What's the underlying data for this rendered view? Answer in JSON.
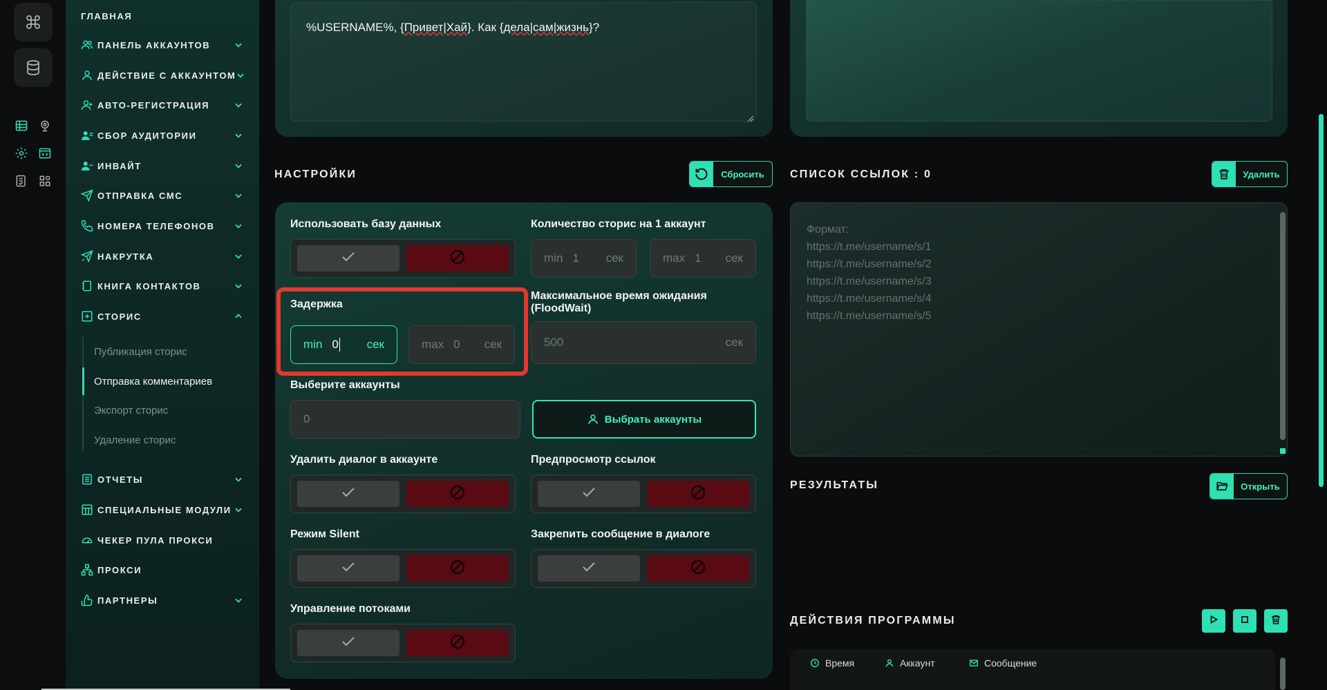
{
  "colors": {
    "accent": "#2ee0b3",
    "danger": "#5a0a12",
    "highlight": "#e2392d",
    "sidebar_bg": "#0f2a26"
  },
  "rail": {
    "icons": [
      "command-icon",
      "database-icon",
      "table-icon",
      "webcam-icon",
      "settings-icon",
      "code-window-icon",
      "checklist-icon",
      "apps-icon"
    ]
  },
  "sidebar": {
    "home": "ГЛАВНАЯ",
    "items": [
      {
        "label": "ПАНЕЛЬ АККАУНТОВ",
        "icon": "users-icon"
      },
      {
        "label": "ДЕЙСТВИЕ С АККАУНТОМ",
        "icon": "user-icon"
      },
      {
        "label": "АВТО-РЕГИСТРАЦИЯ",
        "icon": "user-plus-icon"
      },
      {
        "label": "СБОР АУДИТОРИИ",
        "icon": "user-list-icon"
      },
      {
        "label": "ИНВАЙТ",
        "icon": "user-invite-icon"
      },
      {
        "label": "ОТПРАВКА СМС",
        "icon": "send-icon"
      },
      {
        "label": "НОМЕРА ТЕЛЕФОНОВ",
        "icon": "phone-icon"
      },
      {
        "label": "НАКРУТКА",
        "icon": "boost-send-icon"
      },
      {
        "label": "КНИГА КОНТАКТОВ",
        "icon": "contacts-book-icon"
      },
      {
        "label": "СТОРИС",
        "icon": "stories-plus-icon"
      }
    ],
    "stories_subitems": [
      "Публикация сторис",
      "Отправка комментариев",
      "Экспорт сторис",
      "Удаление сторис"
    ],
    "items_after": [
      {
        "label": "ОТЧЕТЫ",
        "icon": "report-icon"
      },
      {
        "label": "СПЕЦИАЛЬНЫЕ МОДУЛИ",
        "icon": "modules-icon"
      },
      {
        "label": "ЧЕКЕР ПУЛА ПРОКСИ",
        "icon": "gauge-icon"
      },
      {
        "label": "ПРОКСИ",
        "icon": "network-icon"
      },
      {
        "label": "ПАРТНЕРЫ",
        "icon": "thumbs-up-icon"
      }
    ]
  },
  "message": {
    "prefix": "%USERNAME%, {",
    "w1": "Привет",
    "sep1": "|",
    "w2": "Хай",
    "mid": "}. Как {",
    "w3": "дела",
    "sep2": "|",
    "w4": "сам",
    "sep3": "|",
    "w5": "жизнь",
    "suffix": "}?"
  },
  "settings": {
    "title": "НАСТРОЙКИ",
    "reset_label": "Сбросить",
    "use_db_label": "Использовать базу данных",
    "stories_count_label": "Количество сторис на 1 аккаунт",
    "stories_min": {
      "prefix": "min",
      "value": "1",
      "suffix": "сек"
    },
    "stories_max": {
      "prefix": "max",
      "value": "1",
      "suffix": "сек"
    },
    "delay_label": "Задержка",
    "delay_min": {
      "prefix": "min",
      "value": "0",
      "suffix": "сек"
    },
    "delay_max": {
      "prefix": "max",
      "value": "0",
      "suffix": "сек"
    },
    "floodwait_label_1": "Максимальное время ожидания",
    "floodwait_label_2": "(FloodWait)",
    "floodwait": {
      "value": "500",
      "suffix": "сек"
    },
    "select_accounts_label": "Выберите аккаунты",
    "accounts_count": "0",
    "select_accounts_button": "Выбрать аккаунты",
    "delete_dialog_label": "Удалить диалог в аккаунте",
    "link_preview_label": "Предпросмотр ссылок",
    "silent_label": "Режим Silent",
    "pin_message_label": "Закрепить сообщение в диалоге",
    "threads_label": "Управление потоками"
  },
  "links": {
    "title": "СПИСОК ССЫЛОК : 0",
    "delete_label": "Удалить",
    "placeholder": "Формат:\nhttps://t.me/username/s/1\nhttps://t.me/username/s/2\nhttps://t.me/username/s/3\nhttps://t.me/username/s/4\nhttps://t.me/username/s/5"
  },
  "results": {
    "title": "РЕЗУЛЬТАТЫ",
    "open_label": "Открыть"
  },
  "actions": {
    "title": "ДЕЙСТВИЯ ПРОГРАММЫ",
    "columns": [
      {
        "label": "Время",
        "icon": "clock-icon"
      },
      {
        "label": "Аккаунт",
        "icon": "user-icon"
      },
      {
        "label": "Сообщение",
        "icon": "mail-icon"
      }
    ]
  }
}
